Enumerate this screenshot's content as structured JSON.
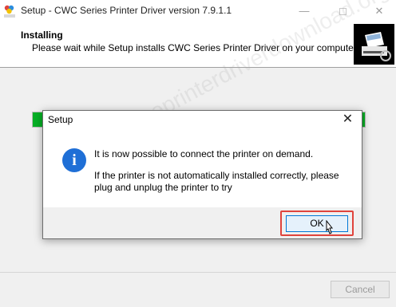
{
  "window": {
    "title": "Setup - CWC Series Printer Driver version 7.9.1.1",
    "app_icon": "app-icon",
    "controls": {
      "minimize_icon": "minimize-icon",
      "maximize_icon": "maximize-icon",
      "close_icon": "close-icon",
      "close_glyph": "✕",
      "minimize_glyph": "—"
    }
  },
  "header": {
    "title": "Installing",
    "subtitle": "Please wait while Setup installs CWC Series Printer Driver on your computer.",
    "image_icon": "printer-icon"
  },
  "progress": {
    "value": 1.0,
    "color": "#06b025"
  },
  "footer": {
    "cancel_label": "Cancel"
  },
  "dialog": {
    "title": "Setup",
    "close_glyph": "✕",
    "info_glyph": "i",
    "message_1": "It is now possible to connect the printer on demand.",
    "message_2": "If the printer is not automatically installed correctly, please plug and unplug the printer to try",
    "ok_label": "OK",
    "highlight_color": "#e0443c"
  },
  "watermark": "www.freeprinterdriverdownload.org"
}
